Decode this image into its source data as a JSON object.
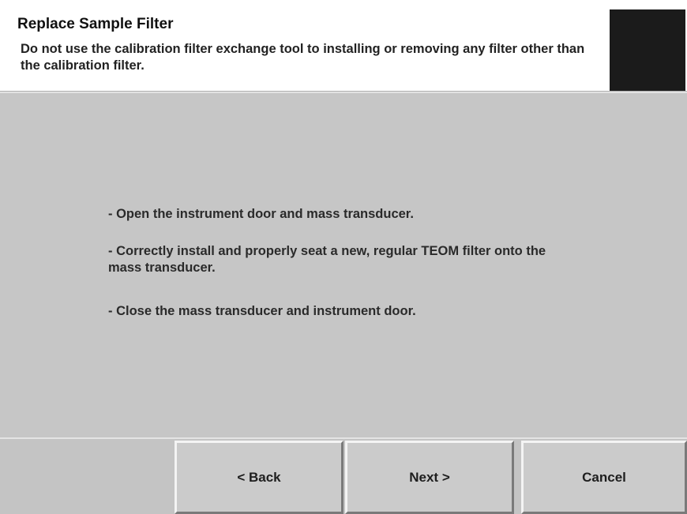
{
  "header": {
    "title": "Replace Sample Filter",
    "subtitle": "Do not use the calibration filter exchange tool to installing or removing any filter other than the calibration filter."
  },
  "instructions": [
    "- Open the instrument door and mass transducer.",
    "- Correctly install and properly seat a new, regular TEOM filter onto the mass transducer.",
    "- Close the mass transducer and instrument door."
  ],
  "buttons": {
    "back": "< Back",
    "next": "Next >",
    "cancel": "Cancel"
  },
  "colors": {
    "header_bg": "#ffffff",
    "panel_bg": "#c6c6c6",
    "status_box": "#1b1b1b"
  }
}
